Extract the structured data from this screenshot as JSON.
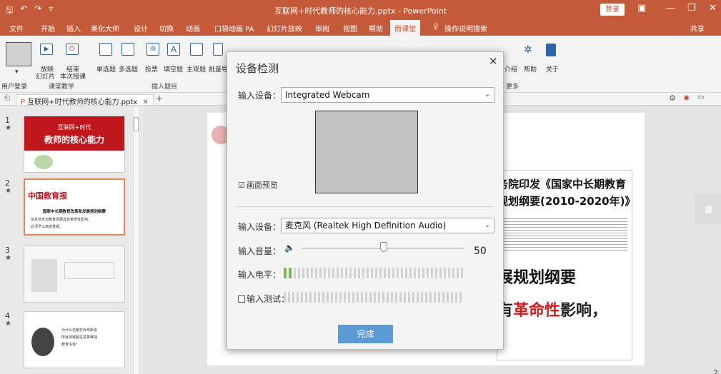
{
  "window": {
    "title": "互联网+时代教师的核心能力.pptx - PowerPoint",
    "login": "登录"
  },
  "menu": {
    "tabs": [
      "文件",
      "开始",
      "插入",
      "美化大师",
      "设计",
      "切换",
      "动画",
      "口袋动画 PA",
      "幻灯片放映",
      "审阅",
      "视图",
      "帮助",
      "雨课堂"
    ],
    "active": "雨课堂",
    "search": "操作说明搜索",
    "share": "共享"
  },
  "ribbon": {
    "user_login": "用户登录",
    "play": "放映",
    "play_sub": "幻灯片",
    "end": "结束",
    "end_sub": "本次授课",
    "single": "单选题",
    "multi": "多选题",
    "vote": "投票",
    "fill": "填空题",
    "subjective": "主观题",
    "batch": "批量导",
    "intro": "介绍",
    "help": "帮助",
    "about": "关于",
    "group_teach": "课堂教学",
    "group_insert": "插入题目",
    "group_more": "更多"
  },
  "doc_tab": {
    "name": "互联网+时代教师的核心能力.pptx",
    "add": "+"
  },
  "thumbnails": [
    {
      "num": "1",
      "title_line1": "互联网+时代",
      "title_line2": "教师的核心能力"
    },
    {
      "num": "2",
      "paper": "中国教育报",
      "headline": "国家中长期教育改革和发展规划纲要",
      "line1": "信息技术对教育发展具有革命性影响，",
      "line2": "必须予以高度重视。"
    },
    {
      "num": "3"
    },
    {
      "num": "4",
      "q1": "为什么史蒂芬乔布斯说",
      "q2": "所有领域都在变革唯独",
      "q3": "教育没有？"
    }
  ],
  "paper": {
    "h1": "务院印发《国家中长期教育",
    "h2": "规划纲要(2010-2020年)》",
    "big1": "展规划纲要",
    "big2_pre": "有",
    "big2_red": "革命性",
    "big2_post": "影响，",
    "page": "2"
  },
  "dialog": {
    "title": "设备检测",
    "video_label": "输入设备：",
    "video_device": "Integrated Webcam",
    "preview_label": "画面预览",
    "preview_checked": "☑",
    "audio_label": "输入设备：",
    "audio_device": "麦克风 (Realtek High Definition Audio)",
    "volume_label": "输入音量：",
    "volume_value": "50",
    "level_label": "输入电平：",
    "test_label": "输入测试：",
    "done": "完成"
  },
  "colors": {
    "accent": "#c55a3a",
    "meter_on": "#78b858",
    "button": "#5b9bd5"
  }
}
